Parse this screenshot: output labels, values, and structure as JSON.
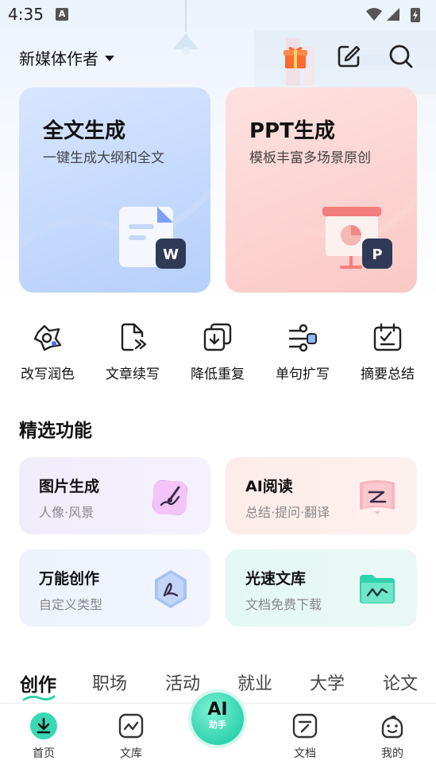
{
  "status_bar": {
    "time": "4:35",
    "notification_badge": "A"
  },
  "header": {
    "account_label": "新媒体作者"
  },
  "hero_cards": [
    {
      "title": "全文生成",
      "subtitle": "一键生成大纲和全文",
      "badge": "W"
    },
    {
      "title": "PPT生成",
      "subtitle": "模板丰富多场景原创",
      "badge": "P"
    }
  ],
  "tools": [
    {
      "label": "改写润色",
      "icon": "rewrite-icon"
    },
    {
      "label": "文章续写",
      "icon": "continue-writing-icon"
    },
    {
      "label": "降低重复",
      "icon": "reduce-duplicate-icon"
    },
    {
      "label": "单句扩写",
      "icon": "expand-sentence-icon"
    },
    {
      "label": "摘要总结",
      "icon": "summary-icon"
    }
  ],
  "featured": {
    "title": "精选功能",
    "items": [
      {
        "title": "图片生成",
        "subtitle": "人像·风景"
      },
      {
        "title": "AI阅读",
        "subtitle": "总结·提问·翻译"
      },
      {
        "title": "万能创作",
        "subtitle": "自定义类型"
      },
      {
        "title": "光速文库",
        "subtitle": "文档免费下载"
      }
    ]
  },
  "category_tabs": [
    "创作",
    "职场",
    "活动",
    "就业",
    "大学",
    "论文"
  ],
  "bottom_nav": {
    "items": [
      "首页",
      "文库",
      "文档",
      "我的"
    ],
    "ai_label": "AI",
    "ai_sublabel": "助手"
  },
  "colors": {
    "accent": "#2fd3ad",
    "text": "#111111",
    "muted": "#888888"
  }
}
